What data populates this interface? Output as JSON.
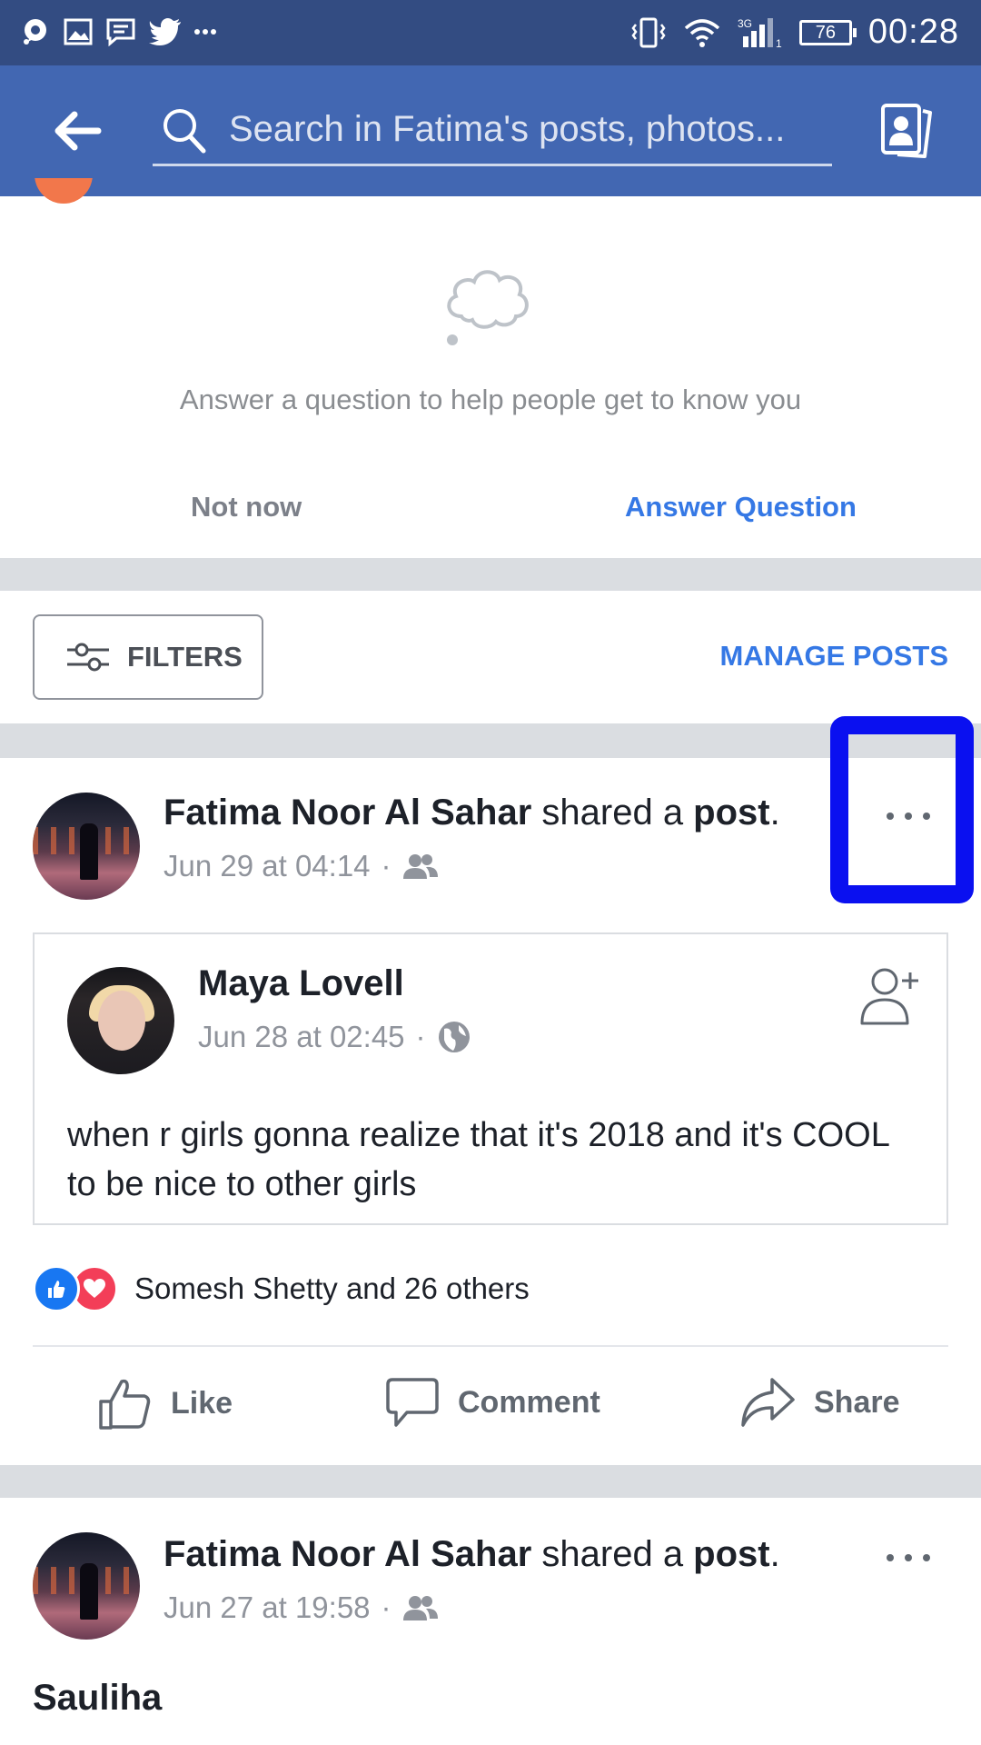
{
  "status_bar": {
    "time": "00:28",
    "battery": "76",
    "network": "3G"
  },
  "app_bar": {
    "search_placeholder": "Search in Fatima's posts, photos..."
  },
  "question_card": {
    "prompt": "Answer a question to help people get to know you",
    "not_now_label": "Not now",
    "answer_label": "Answer Question"
  },
  "toolbar": {
    "filters_label": "FILTERS",
    "manage_label": "MANAGE POSTS"
  },
  "post1": {
    "author": "Fatima Noor Al Sahar",
    "verb": " shared a ",
    "object": "post",
    "period": ".",
    "time": "Jun 29 at 04:14",
    "audience_icon": "friends-icon",
    "shared": {
      "author": "Maya Lovell",
      "time": "Jun 28 at 02:45",
      "audience_icon": "globe-icon",
      "text": "when r girls gonna realize that it's 2018 and it's COOL to be nice to other girls"
    },
    "reactions_text": "Somesh Shetty and 26 others",
    "actions": {
      "like": "Like",
      "comment": "Comment",
      "share": "Share"
    }
  },
  "post2": {
    "author": "Fatima Noor Al Sahar",
    "verb": " shared a ",
    "object": "post",
    "period": ".",
    "time": "Jun 27 at 19:58",
    "audience_icon": "friends-icon",
    "title": "Sauliha"
  },
  "colors": {
    "brand": "#4267b2",
    "statusbar": "#334c82",
    "link_blue": "#3578e5",
    "highlight": "#0a10f0"
  }
}
